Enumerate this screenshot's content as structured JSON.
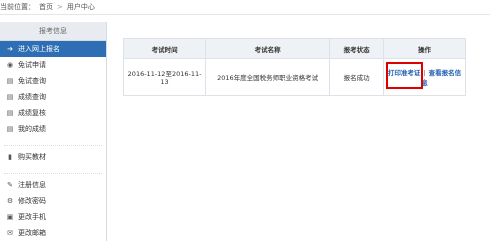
{
  "breadcrumb": {
    "label": "当前位置：",
    "home": "首页",
    "separator": ">",
    "current": "用户中心"
  },
  "sidebar": {
    "header": "报考信息",
    "items": [
      {
        "label": "进入网上报名",
        "icon": "arrow-right-icon",
        "active": true
      },
      {
        "label": "免试申请",
        "icon": "circle-icon"
      },
      {
        "label": "免试查询",
        "icon": "document-icon"
      },
      {
        "label": "成绩查询",
        "icon": "document-icon"
      },
      {
        "label": "成绩复核",
        "icon": "document-icon"
      },
      {
        "label": "我的成绩",
        "icon": "document-icon"
      }
    ],
    "items2": [
      {
        "label": "购买教材",
        "icon": "book-icon"
      }
    ],
    "items3": [
      {
        "label": "注册信息",
        "icon": "wrench-icon"
      },
      {
        "label": "修改密码",
        "icon": "gear-icon"
      },
      {
        "label": "更改手机",
        "icon": "lock-icon"
      },
      {
        "label": "更改邮箱",
        "icon": "mail-icon"
      }
    ]
  },
  "table": {
    "headers": [
      "考试时间",
      "考试名称",
      "报考状态",
      "操作"
    ],
    "row": {
      "time": "2016-11-12至2016-11-13",
      "name": "2016年度全国税务师职业资格考试",
      "status": "报名成功",
      "print": "打印准考证",
      "separator": "|",
      "view": "查看报名信息"
    }
  }
}
